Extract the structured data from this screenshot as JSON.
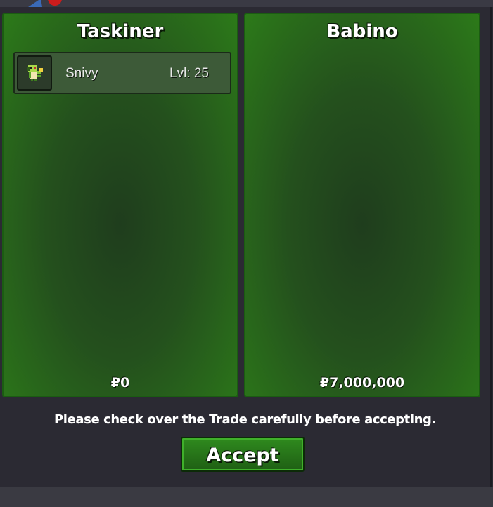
{
  "trade": {
    "left": {
      "name": "Taskiner",
      "pokemon": [
        {
          "name": "Snivy",
          "level": "Lvl: 25",
          "icon": "snivy-sprite-icon"
        }
      ],
      "money": "₽0"
    },
    "right": {
      "name": "Babino",
      "pokemon": [],
      "money": "₽7,000,000"
    },
    "message": "Please check over the Trade carefully before accepting.",
    "accept_label": "Accept"
  },
  "colors": {
    "panel_green": "#2c7a19",
    "panel_dark": "#1f3d1d",
    "background": "#2b2a33",
    "button_green": "#2f8a1e"
  }
}
